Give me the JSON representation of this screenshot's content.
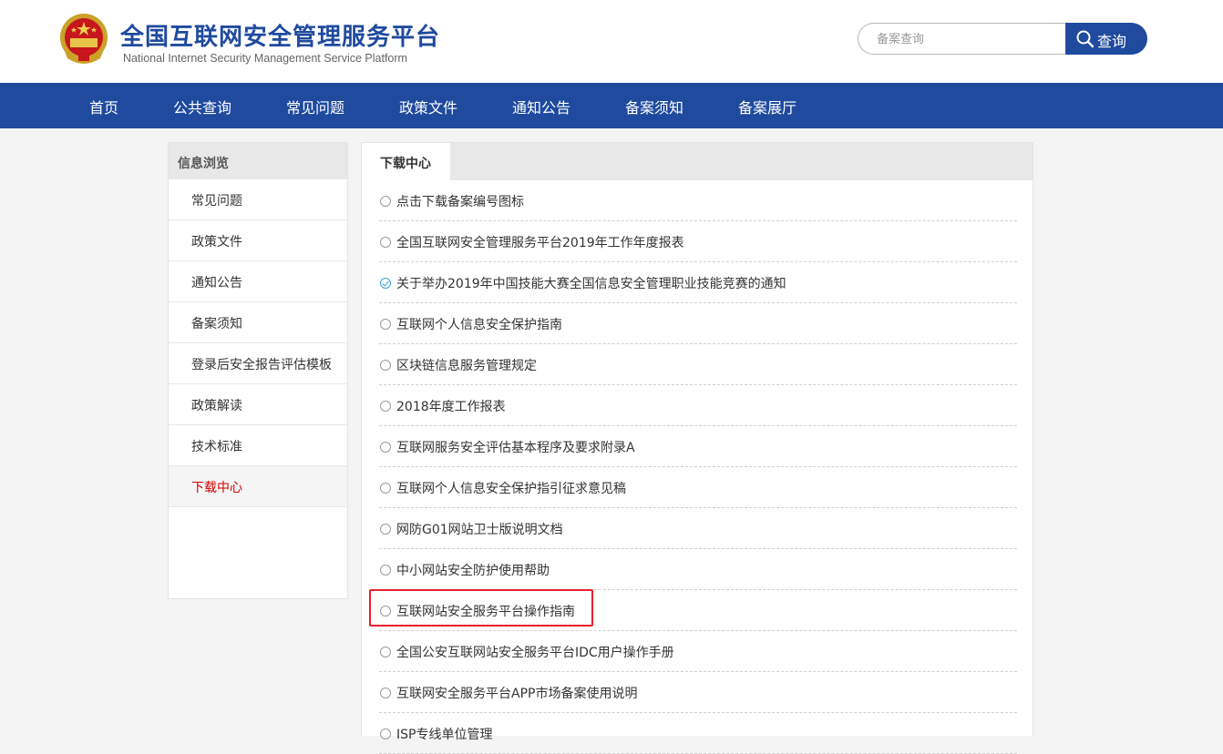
{
  "header": {
    "title": "全国互联网安全管理服务平台",
    "subtitle": "National Internet Security Management Service Platform",
    "logo_icon": "police-emblem-icon",
    "brand_color": "#1f4a9e"
  },
  "search": {
    "placeholder": "备案查询",
    "value": "",
    "button_label": "查询",
    "button_icon": "search-icon"
  },
  "nav": {
    "items": [
      {
        "label": "首页"
      },
      {
        "label": "公共查询"
      },
      {
        "label": "常见问题"
      },
      {
        "label": "政策文件"
      },
      {
        "label": "通知公告"
      },
      {
        "label": "备案须知"
      },
      {
        "label": "备案展厅"
      }
    ]
  },
  "sidebar": {
    "heading": "信息浏览",
    "items": [
      {
        "label": "常见问题"
      },
      {
        "label": "政策文件"
      },
      {
        "label": "通知公告"
      },
      {
        "label": "备案须知"
      },
      {
        "label": "登录后安全报告评估模板"
      },
      {
        "label": "政策解读"
      },
      {
        "label": "技术标准"
      },
      {
        "label": "下载中心"
      }
    ],
    "active_label": "下载中心",
    "active_color": "#d70000"
  },
  "main": {
    "tab_label": "下载中心",
    "downloads": [
      {
        "text": "点击下载备案编号图标"
      },
      {
        "text": "全国互联网安全管理服务平台2019年工作年度报表"
      },
      {
        "text": "关于举办2019年中国技能大赛全国信息安全管理职业技能竞赛的通知",
        "checked": true
      },
      {
        "text": "互联网个人信息安全保护指南"
      },
      {
        "text": "区块链信息服务管理规定"
      },
      {
        "text": "2018年度工作报表"
      },
      {
        "text": "互联网服务安全评估基本程序及要求附录A"
      },
      {
        "text": "互联网个人信息安全保护指引征求意见稿"
      },
      {
        "text": "网防G01网站卫士版说明文档"
      },
      {
        "text": "中小网站安全防护使用帮助"
      },
      {
        "text": "互联网站安全服务平台操作指南",
        "highlighted": true
      },
      {
        "text": "全国公安互联网站安全服务平台IDC用户操作手册"
      },
      {
        "text": "互联网安全服务平台APP市场备案使用说明"
      },
      {
        "text": "ISP专线单位管理"
      }
    ],
    "highlight_color": "#e5202b"
  }
}
